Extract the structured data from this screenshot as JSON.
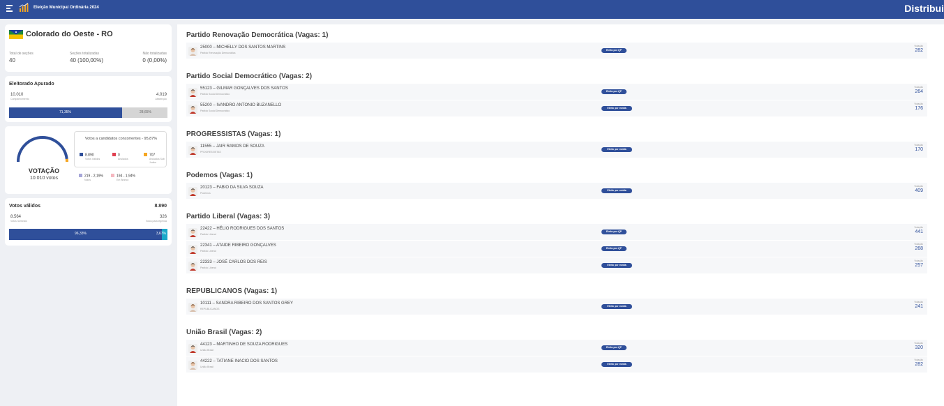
{
  "header": {
    "title": "Eleição Municipal Ordinária 2024",
    "right_title": "Distribui"
  },
  "location": {
    "name": "Colorado do Oeste - RO",
    "stats": [
      {
        "label": "Total de seções",
        "value": "40"
      },
      {
        "label": "Seções totalizadas",
        "value": "40 (100,00%)"
      },
      {
        "label": "Não totalizadas",
        "value": "0 (0,00%)"
      }
    ]
  },
  "eleitorado": {
    "title": "Eleitorado Apurado",
    "comparecimento": "10.010",
    "comparecimento_label": "Comparecimento",
    "abstencao": "4.019",
    "abstencao_label": "Abstenção",
    "comparecimento_pct": "71,35%",
    "abstencao_pct": "28,65%",
    "fill_fraction": 0.7135
  },
  "votacao": {
    "label": "VOTAÇÃO",
    "total": "10.010 votos",
    "box_title": "Votos a candidatos concorrentes - 95,87%",
    "gauge_fraction": 0.96,
    "legend": [
      {
        "value": "8.890",
        "label": "Votos Válidos",
        "color": "#2f4f9a"
      },
      {
        "value": "0",
        "label": "Anulados",
        "color": "#e04050"
      },
      {
        "value": "707",
        "label": "Anulados Sub Judice",
        "color": "#f5a623"
      }
    ],
    "other": [
      {
        "value": "219 - 2,19%",
        "label": "Nulos",
        "color": "#a7a7d8"
      },
      {
        "value": "194 - 1,94%",
        "label": "Em Branco",
        "color": "#f5b8c0"
      }
    ]
  },
  "validos": {
    "title": "Votos válidos",
    "total": "8.890",
    "nominais": "8.564",
    "nominais_label": "Votos nominais",
    "legenda": "326",
    "legenda_label": "Votos para legenda",
    "nominais_pct": "96,33%",
    "legenda_pct": "3,67%",
    "fill_fraction": 0.9633
  },
  "parties": [
    {
      "title": "Partido Renovação Democrática (Vagas: 1)",
      "candidates": [
        {
          "name": "25000 – MICHELLY DOS SANTOS MARTINS",
          "party": "Partido Renovação Democrática",
          "badge": "Eleito por QP",
          "votes_label": "Votação",
          "votes": "282",
          "gender": "f"
        }
      ]
    },
    {
      "title": "Partido Social Democrático (Vagas: 2)",
      "candidates": [
        {
          "name": "55123 – GILMAR GONÇALVES DOS SANTOS",
          "party": "Partido Social Democrático",
          "badge": "Eleito por QP",
          "votes_label": "Votação",
          "votes": "264",
          "gender": "m"
        },
        {
          "name": "55200 – IVANDRO ANTONIO BUZANELLO",
          "party": "Partido Social Democrático",
          "badge": "Eleito por média",
          "votes_label": "Votação",
          "votes": "176",
          "gender": "m"
        }
      ]
    },
    {
      "title": "PROGRESSISTAS (Vagas: 1)",
      "candidates": [
        {
          "name": "11555 – JAIR RAMOS DE SOUZA",
          "party": "PROGRESSISTAS",
          "badge": "Eleito por média",
          "votes_label": "Votação",
          "votes": "170",
          "gender": "m"
        }
      ]
    },
    {
      "title": "Podemos (Vagas: 1)",
      "candidates": [
        {
          "name": "20123 – FABIO DA SILVA SOUZA",
          "party": "Podemos",
          "badge": "Eleito por média",
          "votes_label": "Votação",
          "votes": "409",
          "gender": "m"
        }
      ]
    },
    {
      "title": "Partido Liberal (Vagas: 3)",
      "candidates": [
        {
          "name": "22422 – HÉLIO RODRIGUES DOS SANTOS",
          "party": "Partido Liberal",
          "badge": "Eleito por QP",
          "votes_label": "Votação",
          "votes": "441",
          "gender": "m"
        },
        {
          "name": "22341 – ATAIDE RIBEIRO GONÇALVES",
          "party": "Partido Liberal",
          "badge": "Eleito por QP",
          "votes_label": "Votação",
          "votes": "268",
          "gender": "m"
        },
        {
          "name": "22333 – JOSÉ CARLOS DOS REIS",
          "party": "Partido Liberal",
          "badge": "Eleito por média",
          "votes_label": "Votação",
          "votes": "257",
          "gender": "m"
        }
      ]
    },
    {
      "title": "REPUBLICANOS (Vagas: 1)",
      "candidates": [
        {
          "name": "10111 – SANDRA RIBEIRO DOS SANTOS GREY",
          "party": "REPUBLICANOS",
          "badge": "Eleito por média",
          "votes_label": "Votação",
          "votes": "241",
          "gender": "f"
        }
      ]
    },
    {
      "title": "União Brasil (Vagas: 2)",
      "candidates": [
        {
          "name": "44123 – MARTINHO DE SOUZA RODRIGUES",
          "party": "União Brasil",
          "badge": "Eleito por QP",
          "votes_label": "Votação",
          "votes": "320",
          "gender": "m"
        },
        {
          "name": "44222 – TATIANE INACIO DOS SANTOS",
          "party": "União Brasil",
          "badge": "Eleito por média",
          "votes_label": "Votação",
          "votes": "282",
          "gender": "f"
        }
      ]
    }
  ]
}
